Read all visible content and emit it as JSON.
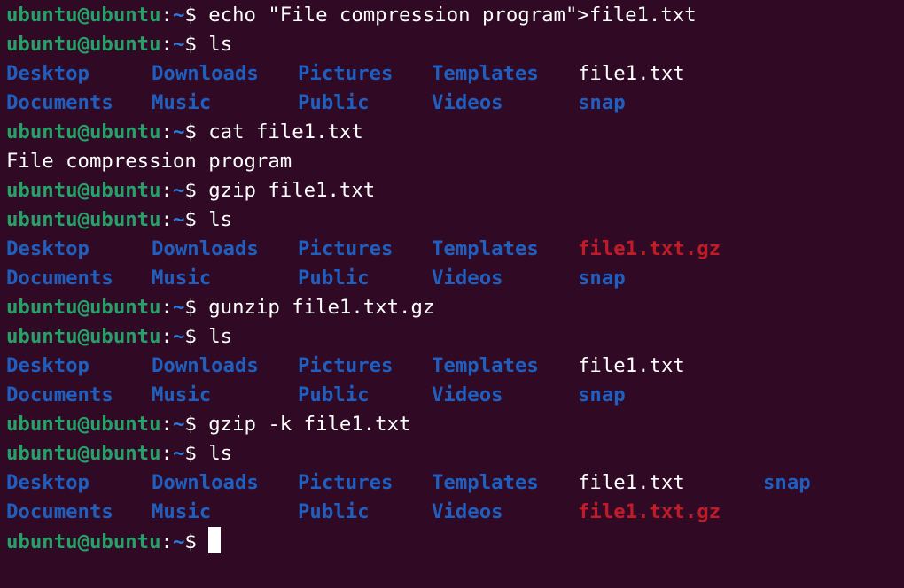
{
  "prompt": {
    "user_host": "ubuntu@ubuntu",
    "separator": ":",
    "path": "~",
    "symbol": "$ "
  },
  "lines": [
    {
      "type": "cmd",
      "command": "echo \"File compression program\">file1.txt"
    },
    {
      "type": "cmd",
      "command": "ls"
    },
    {
      "type": "ls",
      "cells": [
        {
          "text": "Desktop",
          "kind": "dir"
        },
        {
          "text": "Downloads",
          "kind": "dir"
        },
        {
          "text": "Pictures",
          "kind": "dir"
        },
        {
          "text": "Templates",
          "kind": "dir"
        },
        {
          "text": "file1.txt",
          "kind": "file"
        }
      ]
    },
    {
      "type": "ls",
      "cells": [
        {
          "text": "Documents",
          "kind": "dir"
        },
        {
          "text": "Music",
          "kind": "dir"
        },
        {
          "text": "Public",
          "kind": "dir"
        },
        {
          "text": "Videos",
          "kind": "dir"
        },
        {
          "text": "snap",
          "kind": "dir"
        }
      ]
    },
    {
      "type": "cmd",
      "command": "cat file1.txt"
    },
    {
      "type": "output",
      "text": "File compression program"
    },
    {
      "type": "cmd",
      "command": "gzip file1.txt"
    },
    {
      "type": "cmd",
      "command": "ls"
    },
    {
      "type": "ls",
      "cells": [
        {
          "text": "Desktop",
          "kind": "dir"
        },
        {
          "text": "Downloads",
          "kind": "dir"
        },
        {
          "text": "Pictures",
          "kind": "dir"
        },
        {
          "text": "Templates",
          "kind": "dir"
        },
        {
          "text": "file1.txt.gz",
          "kind": "archive"
        }
      ]
    },
    {
      "type": "ls",
      "cells": [
        {
          "text": "Documents",
          "kind": "dir"
        },
        {
          "text": "Music",
          "kind": "dir"
        },
        {
          "text": "Public",
          "kind": "dir"
        },
        {
          "text": "Videos",
          "kind": "dir"
        },
        {
          "text": "snap",
          "kind": "dir"
        }
      ]
    },
    {
      "type": "cmd",
      "command": "gunzip file1.txt.gz"
    },
    {
      "type": "cmd",
      "command": "ls"
    },
    {
      "type": "ls",
      "cells": [
        {
          "text": "Desktop",
          "kind": "dir"
        },
        {
          "text": "Downloads",
          "kind": "dir"
        },
        {
          "text": "Pictures",
          "kind": "dir"
        },
        {
          "text": "Templates",
          "kind": "dir"
        },
        {
          "text": "file1.txt",
          "kind": "file"
        }
      ]
    },
    {
      "type": "ls",
      "cells": [
        {
          "text": "Documents",
          "kind": "dir"
        },
        {
          "text": "Music",
          "kind": "dir"
        },
        {
          "text": "Public",
          "kind": "dir"
        },
        {
          "text": "Videos",
          "kind": "dir"
        },
        {
          "text": "snap",
          "kind": "dir"
        }
      ]
    },
    {
      "type": "cmd",
      "command": "gzip -k file1.txt"
    },
    {
      "type": "cmd",
      "command": "ls"
    },
    {
      "type": "ls",
      "cells": [
        {
          "text": "Desktop",
          "kind": "dir"
        },
        {
          "text": "Downloads",
          "kind": "dir"
        },
        {
          "text": "Pictures",
          "kind": "dir"
        },
        {
          "text": "Templates",
          "kind": "dir"
        },
        {
          "text": "file1.txt",
          "kind": "file"
        },
        {
          "text": "snap",
          "kind": "dir"
        }
      ]
    },
    {
      "type": "ls",
      "cells": [
        {
          "text": "Documents",
          "kind": "dir"
        },
        {
          "text": "Music",
          "kind": "dir"
        },
        {
          "text": "Public",
          "kind": "dir"
        },
        {
          "text": "Videos",
          "kind": "dir"
        },
        {
          "text": "file1.txt.gz",
          "kind": "archive"
        }
      ]
    },
    {
      "type": "cmd",
      "command": "",
      "active": true
    }
  ],
  "colors": {
    "background": "#300a24",
    "prompt_user": "#26a269",
    "prompt_path": "#2a7bde",
    "directory": "#1f5fbf",
    "archive": "#c01c28",
    "text": "#ffffff"
  }
}
